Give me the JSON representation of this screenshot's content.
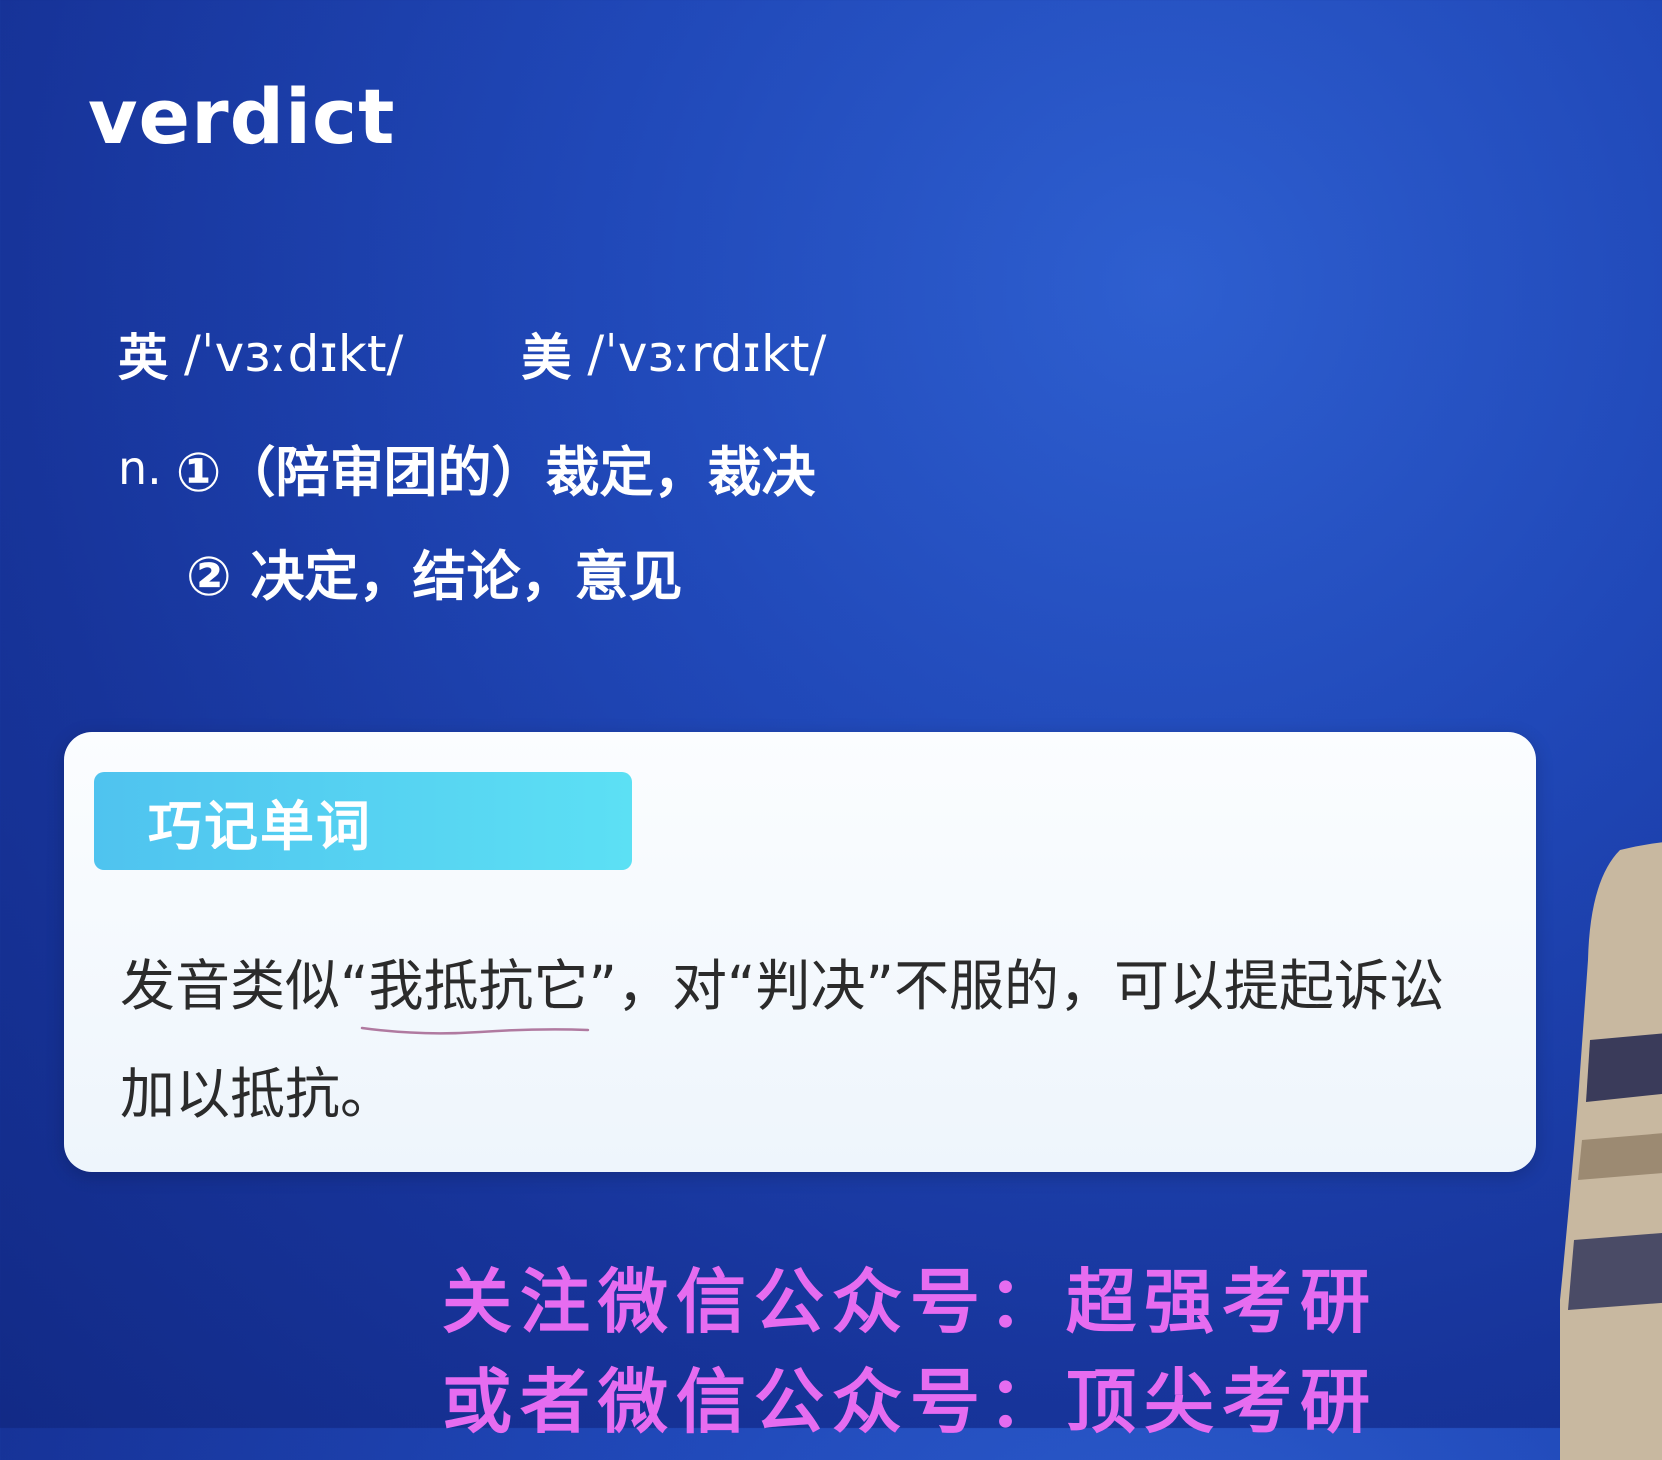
{
  "word": "verdict",
  "phonetics": {
    "uk_label": "英",
    "uk_ipa": "/ˈvɜːdɪkt/",
    "us_label": "美",
    "us_ipa": "/ˈvɜːrdɪkt/"
  },
  "definitions": {
    "pos": "n.",
    "items": [
      "①（陪审团的）裁定，裁决",
      "② 决定，结论，意见"
    ]
  },
  "mnemonic": {
    "tag": "巧记单词",
    "text": "发音类似“我抵抗它”，对“判决”不服的，可以提起诉讼加以抵抗。"
  },
  "promo": {
    "line1": "关注微信公众号：超强考研",
    "line2": "或者微信公众号：顶尖考研"
  },
  "colors": {
    "background": "#1f45b3",
    "tag": "#4fc3ef",
    "promo": "#e66cf0"
  }
}
